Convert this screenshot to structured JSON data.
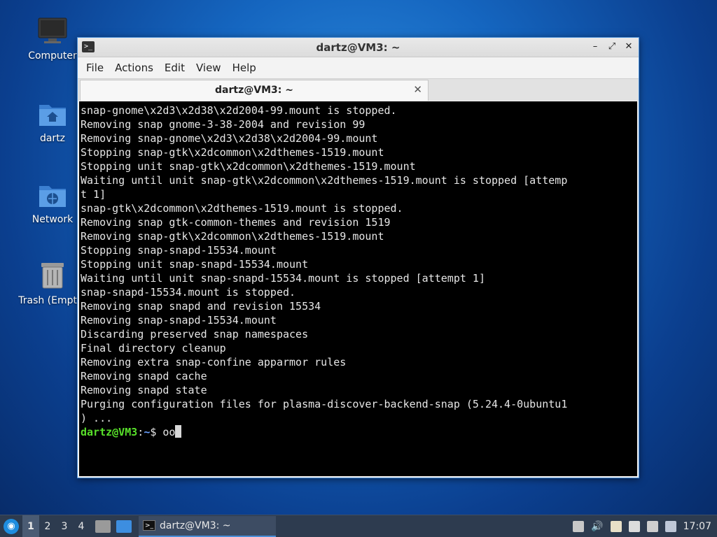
{
  "desktop": {
    "icons": [
      {
        "label": "Computer"
      },
      {
        "label": "dartz"
      },
      {
        "label": "Network"
      },
      {
        "label": "Trash (Empty)"
      }
    ]
  },
  "window": {
    "title": "dartz@VM3: ~",
    "menu": [
      "File",
      "Actions",
      "Edit",
      "View",
      "Help"
    ],
    "tab_label": "dartz@VM3: ~",
    "terminal_lines": [
      "snap-gnome\\x2d3\\x2d38\\x2d2004-99.mount is stopped.",
      "Removing snap gnome-3-38-2004 and revision 99",
      "Removing snap-gnome\\x2d3\\x2d38\\x2d2004-99.mount",
      "Stopping snap-gtk\\x2dcommon\\x2dthemes-1519.mount",
      "Stopping unit snap-gtk\\x2dcommon\\x2dthemes-1519.mount",
      "Waiting until unit snap-gtk\\x2dcommon\\x2dthemes-1519.mount is stopped [attemp",
      "t 1]",
      "snap-gtk\\x2dcommon\\x2dthemes-1519.mount is stopped.",
      "Removing snap gtk-common-themes and revision 1519",
      "Removing snap-gtk\\x2dcommon\\x2dthemes-1519.mount",
      "Stopping snap-snapd-15534.mount",
      "Stopping unit snap-snapd-15534.mount",
      "Waiting until unit snap-snapd-15534.mount is stopped [attempt 1]",
      "snap-snapd-15534.mount is stopped.",
      "Removing snap snapd and revision 15534",
      "Removing snap-snapd-15534.mount",
      "Discarding preserved snap namespaces",
      "Final directory cleanup",
      "Removing extra snap-confine apparmor rules",
      "Removing snapd cache",
      "Removing snapd state",
      "Purging configuration files for plasma-discover-backend-snap (5.24.4-0ubuntu1",
      ") ..."
    ],
    "prompt": {
      "user_host": "dartz@VM3",
      "sep": ":",
      "path": "~",
      "symbol": "$ ",
      "input": "oo"
    }
  },
  "taskbar": {
    "workspaces": [
      "1",
      "2",
      "3",
      "4"
    ],
    "task_label": "dartz@VM3: ~",
    "clock": "17:07"
  }
}
